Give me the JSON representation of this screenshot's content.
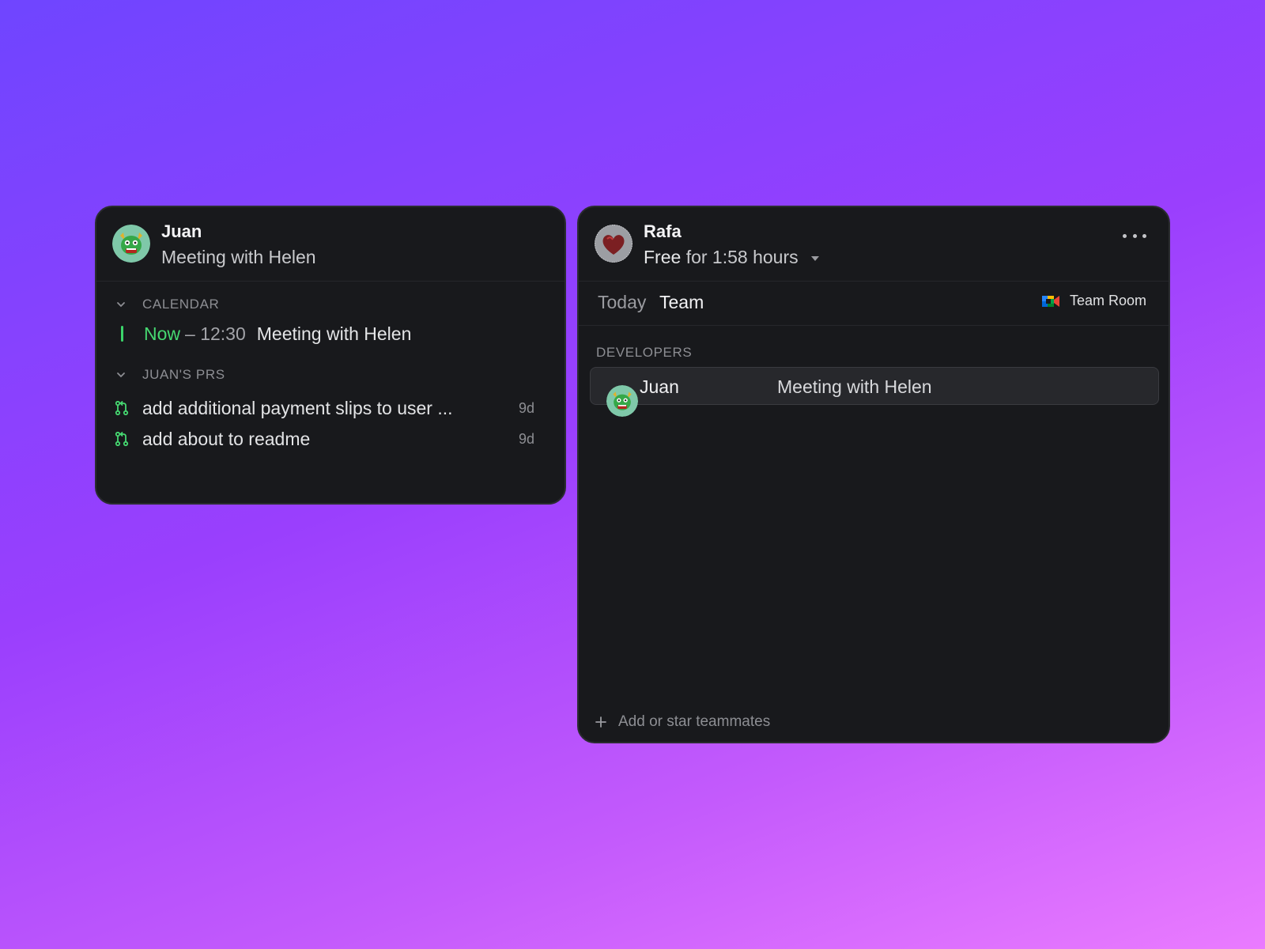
{
  "juan_card": {
    "name": "Juan",
    "status": "Meeting with Helen",
    "calendar": {
      "heading": "CALENDAR",
      "now_label": "Now",
      "time": "– 12:30",
      "event_title": "Meeting with Helen"
    },
    "prs": {
      "heading": "JUAN'S PRS",
      "items": [
        {
          "title": "add additional payment slips to user ...",
          "age": "9d"
        },
        {
          "title": "add about to readme",
          "age": "9d"
        }
      ]
    }
  },
  "rafa_card": {
    "name": "Rafa",
    "availability": "Free",
    "availability_detail": "for 1:58 hours",
    "tabs": [
      "Today",
      "Team"
    ],
    "team_room_label": "Team Room",
    "group_heading": "DEVELOPERS",
    "members": [
      {
        "name": "Juan",
        "status": "Meeting with Helen"
      }
    ],
    "add_label": "Add or star teammates"
  },
  "icons": {
    "juan_avatar": "dragon-avatar-icon",
    "rafa_avatar": "heart-avatar-icon",
    "pr": "pull-request-icon",
    "meet": "google-meet-icon"
  },
  "colors": {
    "accent_green": "#46d871",
    "card_bg": "#18191c"
  }
}
